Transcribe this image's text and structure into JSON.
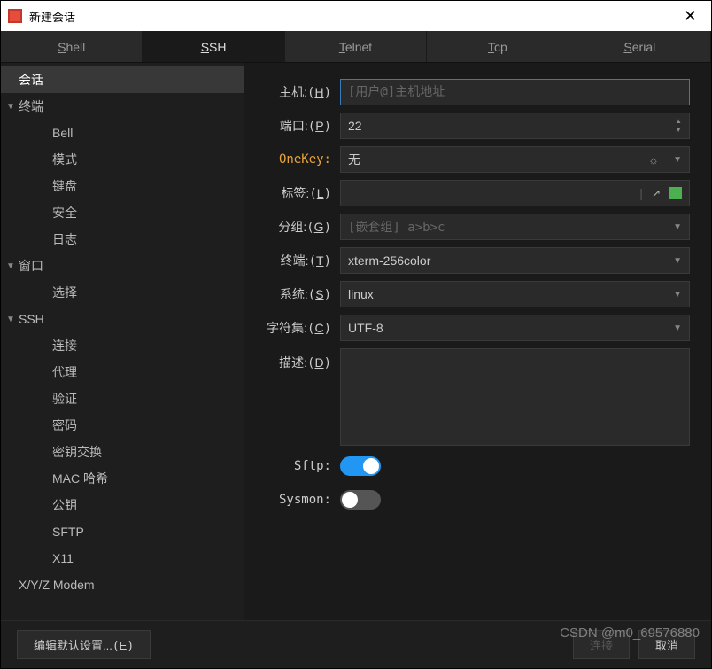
{
  "window": {
    "title": "新建会话"
  },
  "tabs": [
    {
      "label": "Shell",
      "underline": "S",
      "rest": "hell"
    },
    {
      "label": "SSH",
      "underline": "S",
      "rest": "SH",
      "active": true
    },
    {
      "label": "Telnet",
      "underline": "T",
      "rest": "elnet"
    },
    {
      "label": "Tcp",
      "underline": "T",
      "rest": "cp"
    },
    {
      "label": "Serial",
      "underline": "S",
      "rest": "erial"
    }
  ],
  "sidebar": {
    "items": [
      "会话",
      "终端",
      "Bell",
      "模式",
      "键盘",
      "安全",
      "日志",
      "窗口",
      "选择",
      "SSH",
      "连接",
      "代理",
      "验证",
      "密码",
      "密钥交换",
      "MAC 哈希",
      "公钥",
      "SFTP",
      "X11",
      "X/Y/Z Modem"
    ]
  },
  "form": {
    "host": {
      "label": "主机:",
      "hotkey": "H",
      "placeholder": "[用户@]主机地址",
      "value": ""
    },
    "port": {
      "label": "端口:",
      "hotkey": "P",
      "value": "22"
    },
    "onekey": {
      "label": "OneKey:",
      "value": "无"
    },
    "tags": {
      "label": "标签:",
      "hotkey": "L",
      "value": ""
    },
    "group": {
      "label": "分组:",
      "hotkey": "G",
      "placeholder": "[嵌套组] a>b>c",
      "value": ""
    },
    "terminal": {
      "label": "终端:",
      "hotkey": "T",
      "value": "xterm-256color"
    },
    "system": {
      "label": "系统:",
      "hotkey": "S",
      "value": "linux"
    },
    "charset": {
      "label": "字符集:",
      "hotkey": "C",
      "value": "UTF-8"
    },
    "description": {
      "label": "描述:",
      "hotkey": "D",
      "value": ""
    },
    "sftp": {
      "label": "Sftp:",
      "value": true
    },
    "sysmon": {
      "label": "Sysmon:",
      "value": false
    }
  },
  "footer": {
    "edit_defaults": "编辑默认设置...",
    "edit_defaults_hotkey": "E",
    "connect": "连接",
    "cancel": "取消"
  },
  "watermark": "CSDN @m0_69576880"
}
